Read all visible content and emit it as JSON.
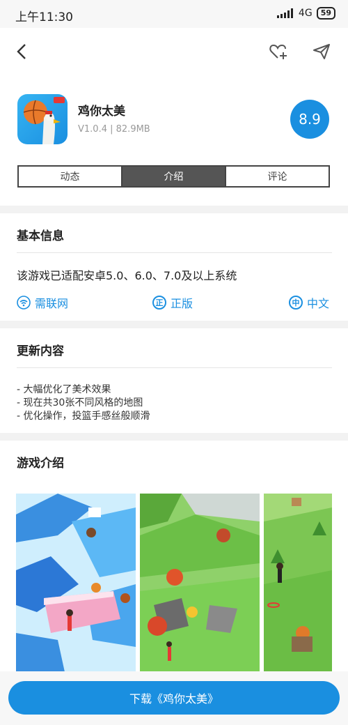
{
  "status_bar": {
    "time": "上午11:30",
    "network": "4G",
    "battery": "59"
  },
  "app": {
    "name": "鸡你太美",
    "version": "V1.0.4",
    "size": "82.9MB",
    "rating": "8.9"
  },
  "tabs": [
    {
      "label": "动态",
      "active": false
    },
    {
      "label": "介绍",
      "active": true
    },
    {
      "label": "评论",
      "active": false
    }
  ],
  "basic_info": {
    "title": "基本信息",
    "compat": "该游戏已适配安卓5.0、6.0、7.0及以上系统",
    "tags": [
      {
        "icon": "wifi-icon",
        "label": "需联网"
      },
      {
        "icon": "genuine-icon",
        "label": "正版",
        "glyph": "正"
      },
      {
        "icon": "chinese-icon",
        "label": "中文",
        "glyph": "中"
      }
    ]
  },
  "update": {
    "title": "更新内容",
    "notes": [
      "- 大幅优化了美术效果",
      "- 现在共30张不同风格的地图",
      "- 优化操作，投篮手感丝般顺滑"
    ]
  },
  "intro": {
    "title": "游戏介绍"
  },
  "download": {
    "label": "下载《鸡你太美》"
  },
  "colors": {
    "accent": "#1a8fe0"
  }
}
